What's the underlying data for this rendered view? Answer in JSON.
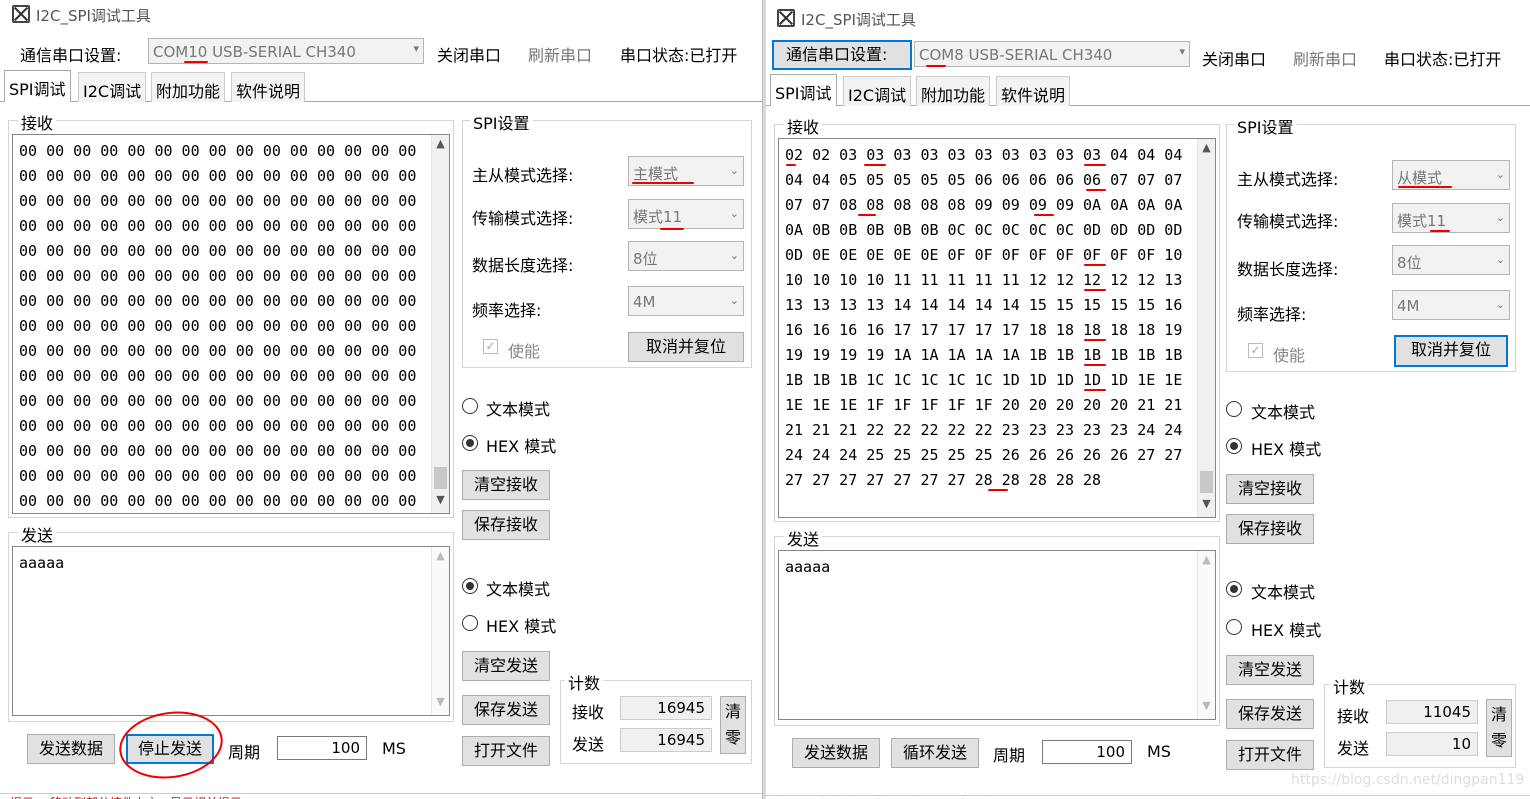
{
  "left": {
    "title": "I2C_SPI调试工具",
    "toolbar": {
      "port_label": "通信串口设置:",
      "port_value": "COM10 USB-SERIAL CH340",
      "close_port": "关闭串口",
      "refresh_port": "刷新串口",
      "port_status": "串口状态:已打开"
    },
    "tabs": [
      "SPI调试",
      "I2C调试",
      "附加功能",
      "软件说明"
    ],
    "receive": {
      "label": "接收",
      "text": "00 00 00 00 00 00 00 00 00 00 00 00 00 00 00 00 00 00 00 00 00 00 00 00 00 00 00 00 00 00 00 00 00 00 00 00 00 00 00 00 00 00 00 00 00 00 00 00 00 00 00 00 00 00 00 00 00 00 00 00 00 00 00 00 00 00 00 00 00 00 00 00 00 00 00 00 00 00 00 00 00 00 00 00 00 00 00 00 00 00 00 00 00 00 00 00 00 00 00 00 00 00 00 00 00 00 00 00 00 00 00 00 00 00 00 00 00 00 00 00 00 00 00 00 00 00 00 00 00 00 00 00 00 00 00 00 00 00 00 00 00 00 00 00 00 00 00 00 00 00 00 00 00 00 00 00 00 00 00 00 00 00 00 00 00 00 00 00 00 00 00 00 00 00 00 00 00 00 00 00 00 00 00 00 00 00 00 00 00 00 00 00 00 00 00 00 00 00 00 00 00 00 00 00 00 00 00 00 00 00 00 00 00 00 00 00 00 00 00 00 00 00 00 00 00 00 00 00 00 00 00 00 00 00 00 00 00 00 00 00 00 00 00 00 00 00 00 00 00 00 00 00 00 00 00 00 00 00 00 00 00 00 00 00 00 00 00 00 00 00 00 00 00 00 00 00 00 00 00 00 00 00"
    },
    "spi": {
      "label": "SPI设置",
      "mode_label": "主从模式选择:",
      "mode_value": "主模式",
      "trans_label": "传输模式选择:",
      "trans_value": "模式11",
      "len_label": "数据长度选择:",
      "len_value": "8位",
      "freq_label": "频率选择:",
      "freq_value": "4M",
      "enable_label": "使能",
      "cancel_reset": "取消并复位"
    },
    "recv_opts": {
      "text_mode": "文本模式",
      "hex_mode": "HEX 模式",
      "clear": "清空接收",
      "save": "保存接收"
    },
    "send": {
      "label": "发送",
      "text": "aaaaa"
    },
    "send_opts": {
      "text_mode": "文本模式",
      "hex_mode": "HEX 模式",
      "clear": "清空发送",
      "save": "保存发送",
      "open_file": "打开文件"
    },
    "count": {
      "label": "计数",
      "recv_label": "接收",
      "recv_value": "16945",
      "send_label": "发送",
      "send_value": "16945",
      "clear": "清零"
    },
    "bottom": {
      "send_data": "发送数据",
      "loop_send": "停止发送",
      "period_label": "周期",
      "period_value": "100",
      "unit": "MS"
    },
    "status": "提示： 移动到部分控件上方，显示相关提示"
  },
  "right": {
    "title": "I2C_SPI调试工具",
    "toolbar": {
      "port_label": "通信串口设置:",
      "port_value": "COM8 USB-SERIAL CH340",
      "close_port": "关闭串口",
      "refresh_port": "刷新串口",
      "port_status": "串口状态:已打开"
    },
    "tabs": [
      "SPI调试",
      "I2C调试",
      "附加功能",
      "软件说明"
    ],
    "receive": {
      "label": "接收",
      "text": "02 02 03 03 03 03 03 03 03 03 03 03 04 04 04 04 04 05 05 05 05 05 06 06 06 06 06 07 07 07 07 07 08 08 08 08 08 09 09 09 09 0A 0A 0A 0A 0A 0B 0B 0B 0B 0B 0C 0C 0C 0C 0C 0D 0D 0D 0D 0D 0E 0E 0E 0E 0E 0F 0F 0F 0F 0F 0F 0F 0F 10 10 10 10 10 11 11 11 11 11 12 12 12 12 12 13 13 13 13 13 14 14 14 14 14 15 15 15 15 15 16 16 16 16 16 17 17 17 17 17 18 18 18 18 18 19 19 19 19 19 1A 1A 1A 1A 1A 1B 1B 1B 1B 1B 1B 1B 1B 1B 1C 1C 1C 1C 1C 1D 1D 1D 1D 1D 1E 1E 1E 1E 1E 1F 1F 1F 1F 1F 20 20 20 20 20 21 21 21 21 21 22 22 22 22 22 23 23 23 23 23 24 24 24 24 24 25 25 25 25 25 26 26 26 26 26 27 27 27 27 27 27 27 27 27 28 28 28 28 28"
    },
    "spi": {
      "label": "SPI设置",
      "mode_label": "主从模式选择:",
      "mode_value": "从模式",
      "trans_label": "传输模式选择:",
      "trans_value": "模式11",
      "len_label": "数据长度选择:",
      "len_value": "8位",
      "freq_label": "频率选择:",
      "freq_value": "4M",
      "enable_label": "使能",
      "cancel_reset": "取消并复位"
    },
    "recv_opts": {
      "text_mode": "文本模式",
      "hex_mode": "HEX 模式",
      "clear": "清空接收",
      "save": "保存接收"
    },
    "send": {
      "label": "发送",
      "text": "aaaaa"
    },
    "send_opts": {
      "text_mode": "文本模式",
      "hex_mode": "HEX 模式",
      "clear": "清空发送",
      "save": "保存发送",
      "open_file": "打开文件"
    },
    "count": {
      "label": "计数",
      "recv_label": "接收",
      "recv_value": "11045",
      "send_label": "发送",
      "send_value": "10",
      "clear": "清零"
    },
    "bottom": {
      "send_data": "发送数据",
      "loop_send": "循环发送",
      "period_label": "周期",
      "period_value": "100",
      "unit": "MS"
    },
    "status": "提示： 移动到部分控件上方，显示相关提示"
  },
  "watermark": "https://blog.csdn.net/dingpan119",
  "colors": {
    "annotation": "#e00000",
    "focus": "#0078d7"
  }
}
